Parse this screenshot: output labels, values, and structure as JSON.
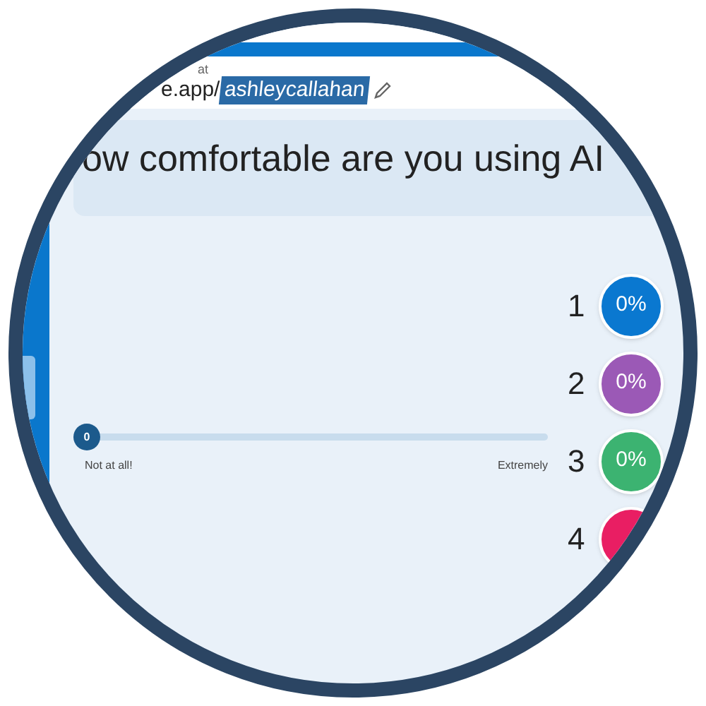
{
  "url": {
    "label": "at",
    "prefix": "e.app/",
    "handle": "ashleycallahan"
  },
  "question": "ow comfortable are you using AI",
  "slider": {
    "level": 0,
    "value": "0",
    "min_label": "Not at all!",
    "max_label": "Extremely"
  },
  "options": [
    {
      "number": "1",
      "percent": "0%",
      "color": "#0a78d0"
    },
    {
      "number": "2",
      "percent": "0%",
      "color": "#9b59b6"
    },
    {
      "number": "3",
      "percent": "0%",
      "color": "#3cb371"
    },
    {
      "number": "4",
      "color": "#e91e63"
    }
  ]
}
